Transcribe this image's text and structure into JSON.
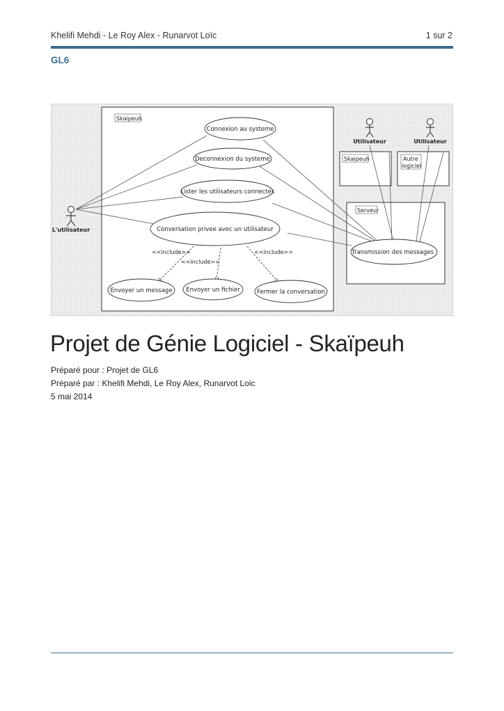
{
  "header": {
    "authors": "Khelifi Mehdi - Le Roy Alex - Runarvot Loïc",
    "page_indicator": "1 sur 2",
    "section": "GL6"
  },
  "diagram": {
    "system_label": "Skaipeuh",
    "actor_label": "L'utilisateur",
    "use_cases": {
      "connexion": "Connexion au systeme",
      "deconnexion": "Deconnexion du systeme",
      "lister": "Lister les utilisateurs connectés",
      "conversation": "Conversation privee avec un utilisateur",
      "envoyer_message": "Envoyer un message",
      "envoyer_fichier": "Envoyer un fichier",
      "fermer": "Fermer la conversation",
      "transmission": "Transmission des messages"
    },
    "include_label": "<<include>>",
    "remote_actor_1": "Utilisateur",
    "remote_actor_2": "Utilisateur",
    "box_skaipeuh": "Skaipeuh",
    "box_autre_line1": "Autre",
    "box_autre_line2": "logiciel",
    "box_serveur": "Serveur"
  },
  "document": {
    "title": "Projet de Génie Logiciel - Skaïpeuh",
    "prepared_for_label": "Préparé pour  :",
    "prepared_for_value": "Projet de GL6",
    "prepared_by_label": "Préparé par  :",
    "prepared_by_value": "Khelifi Mehdi, Le Roy Alex, Runarvot Loic",
    "date": "5 mai 2014"
  }
}
